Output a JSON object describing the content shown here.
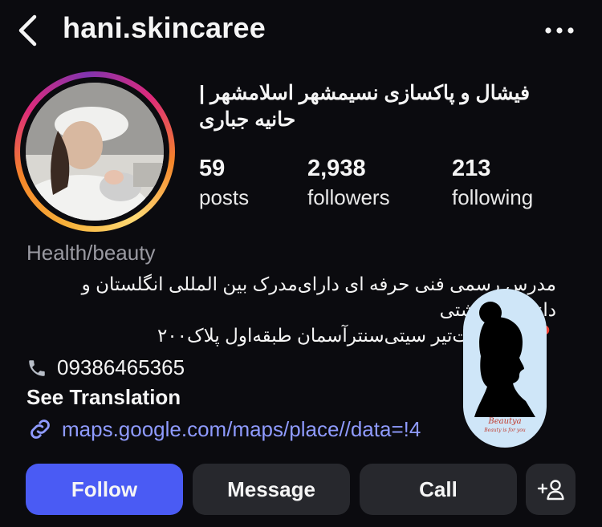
{
  "header": {
    "username": "hani.skincaree"
  },
  "profile": {
    "full_name": "فیشال و پاکسازی نسیمشهر اسلامشهر | حانیه جباری",
    "stats": [
      {
        "value": "59",
        "label": "posts"
      },
      {
        "value": "2,938",
        "label": "followers"
      },
      {
        "value": "213",
        "label": "following"
      }
    ],
    "category": "Health/beauty",
    "bio_lines": [
      "مدرس رسمی فنی حرفه ای دارای‌مدرک بین المللی انگلستان و",
      "دانشگاه بهشتی",
      "📍میدان‌هفت‌تیر سیتی‌سنترآسمان طبقه‌اول پلاک۲۰۰"
    ],
    "phone": "09386465365",
    "see_translation": "See Translation",
    "link": "maps.google.com/maps/place//data=!4"
  },
  "sticker": {
    "brand": "Beautya",
    "tagline": "Beauty is for you"
  },
  "actions": {
    "follow": "Follow",
    "message": "Message",
    "call": "Call"
  },
  "icons": {
    "back": "chevron-left-icon",
    "more": "more-horizontal-icon",
    "phone": "phone-icon",
    "link": "link-icon",
    "add_person": "add-person-icon"
  },
  "colors": {
    "background": "#0b0b0f",
    "follow_button": "#4a5bf4",
    "secondary_button": "#27282d",
    "link": "#8f9bff",
    "muted_text": "#9a9aa2"
  }
}
